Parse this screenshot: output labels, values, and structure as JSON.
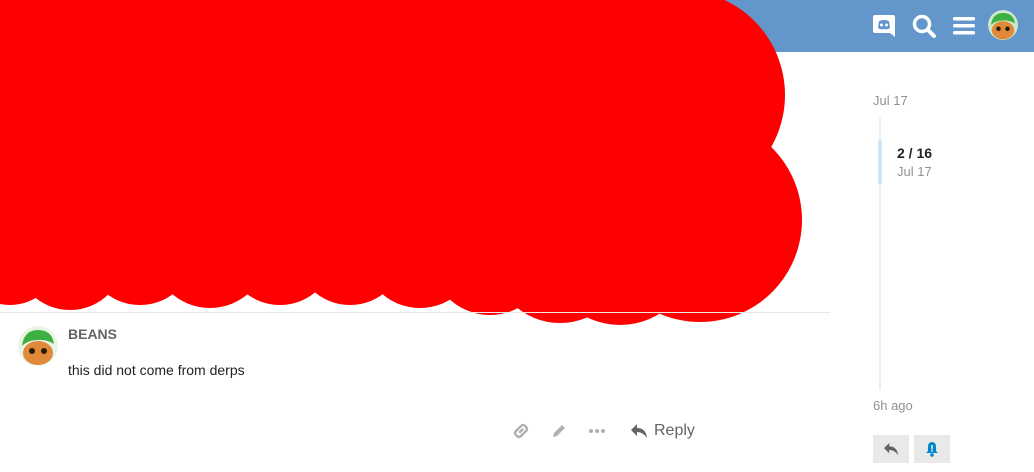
{
  "header": {
    "icons": [
      "discord-icon",
      "search-icon",
      "hamburger-menu-icon",
      "user-avatar"
    ],
    "background_color": "#6397cc"
  },
  "post": {
    "username": "BEANS",
    "body": "this did not come from derps",
    "avatar_icon": "green-cap-character-avatar",
    "action_icons": [
      "link-icon",
      "edit-pencil-icon",
      "more-ellipsis-icon"
    ],
    "reply_label": "Reply"
  },
  "timeline": {
    "start_date": "Jul 17",
    "position": "2 / 16",
    "current_date": "Jul 17",
    "end_label": "6h ago",
    "buttons": [
      "reply-arrow-icon",
      "notification-bell-icon"
    ]
  },
  "colors": {
    "accent": "#6397cc",
    "redaction": "#ff0000",
    "muted_text": "#919191",
    "bell": "#0088cc"
  }
}
